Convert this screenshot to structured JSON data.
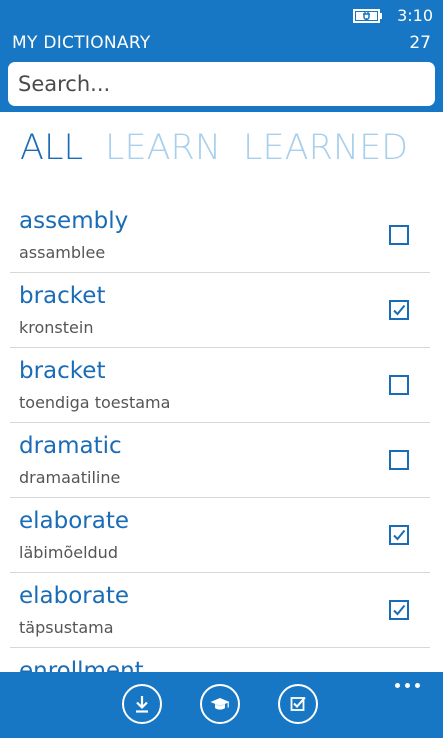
{
  "status_bar": {
    "time": "3:10",
    "battery_icon": "battery-charging-icon"
  },
  "header": {
    "title": "MY DICTIONARY",
    "count": "27"
  },
  "search": {
    "placeholder": "Search..."
  },
  "pivot": {
    "tabs": [
      "ALL",
      "LEARN",
      "LEARNED"
    ],
    "selected": "ALL"
  },
  "entries": [
    {
      "word": "assembly",
      "translation": "assamblee",
      "learned": false
    },
    {
      "word": "bracket",
      "translation": "kronstein",
      "learned": true
    },
    {
      "word": "bracket",
      "translation": "toendiga toestama",
      "learned": false
    },
    {
      "word": "dramatic",
      "translation": "dramaatiline",
      "learned": false
    },
    {
      "word": "elaborate",
      "translation": "läbimõeldud",
      "learned": true
    },
    {
      "word": "elaborate",
      "translation": "täpsustama",
      "learned": true
    },
    {
      "word": "enrollment",
      "translation": "",
      "learned": false
    }
  ],
  "app_bar": {
    "buttons": [
      "download-icon",
      "graduation-cap-icon",
      "checklist-icon"
    ],
    "more_icon": "more-dots-icon"
  },
  "colors": {
    "accent": "#1777c4",
    "text_accent": "#1a6cb6",
    "pivot_inactive": "#a8d0ec"
  }
}
